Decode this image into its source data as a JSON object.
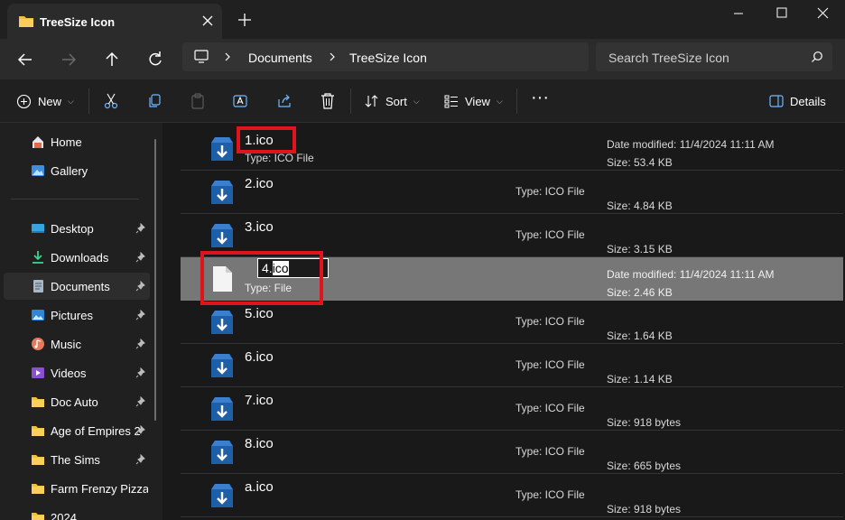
{
  "window": {
    "tab_title": "TreeSize Icon",
    "new_tab_symbol": "+"
  },
  "address": {
    "crumbs": [
      "Documents",
      "TreeSize Icon"
    ],
    "search_placeholder": "Search TreeSize Icon"
  },
  "toolbar": {
    "new_label": "New",
    "sort_label": "Sort",
    "view_label": "View",
    "more_label": "···",
    "details_label": "Details"
  },
  "sidebar": {
    "items": [
      {
        "label": "Home",
        "icon": "home-icon",
        "pinned": false
      },
      {
        "label": "Gallery",
        "icon": "gallery-icon",
        "pinned": false
      },
      {
        "label": "Desktop",
        "icon": "desktop-icon",
        "pinned": true
      },
      {
        "label": "Downloads",
        "icon": "downloads-icon",
        "pinned": true
      },
      {
        "label": "Documents",
        "icon": "documents-icon",
        "pinned": true
      },
      {
        "label": "Pictures",
        "icon": "pictures-icon",
        "pinned": true
      },
      {
        "label": "Music",
        "icon": "music-icon",
        "pinned": true
      },
      {
        "label": "Videos",
        "icon": "videos-icon",
        "pinned": true
      },
      {
        "label": "Doc Auto",
        "icon": "folder-icon",
        "pinned": true
      },
      {
        "label": "Age of Empires 2",
        "icon": "folder-icon",
        "pinned": true
      },
      {
        "label": "The Sims",
        "icon": "folder-icon",
        "pinned": true
      },
      {
        "label": "Farm Frenzy Pizza Pa",
        "icon": "folder-icon",
        "pinned": false
      },
      {
        "label": "2024",
        "icon": "folder-icon",
        "pinned": false
      }
    ]
  },
  "files": [
    {
      "name": "1.ico",
      "type": "Type: ICO File",
      "date": "Date modified: 11/4/2024 11:11 AM",
      "size": "Size: 53.4 KB"
    },
    {
      "name": "2.ico",
      "type": "Type: ICO File",
      "date": "",
      "size": "Size: 4.84 KB"
    },
    {
      "name": "3.ico",
      "type": "Type: ICO File",
      "date": "",
      "size": "Size: 3.15 KB"
    },
    {
      "name": "4.ico",
      "name_prefix": "4.",
      "name_selected": "ico",
      "type": "Type: File",
      "date": "Date modified: 11/4/2024 11:11 AM",
      "size": "Size: 2.46 KB"
    },
    {
      "name": "5.ico",
      "type": "Type: ICO File",
      "date": "",
      "size": "Size: 1.64 KB"
    },
    {
      "name": "6.ico",
      "type": "Type: ICO File",
      "date": "",
      "size": "Size: 1.14 KB"
    },
    {
      "name": "7.ico",
      "type": "Type: ICO File",
      "date": "",
      "size": "Size: 918 bytes"
    },
    {
      "name": "8.ico",
      "type": "Type: ICO File",
      "date": "",
      "size": "Size: 665 bytes"
    },
    {
      "name": "a.ico",
      "type": "Type: ICO File",
      "date": "",
      "size": "Size: 918 bytes"
    }
  ],
  "colors": {
    "highlight": "#e0141c",
    "folder": "#f2bf42",
    "icon_blue": "#1f5fa8"
  }
}
